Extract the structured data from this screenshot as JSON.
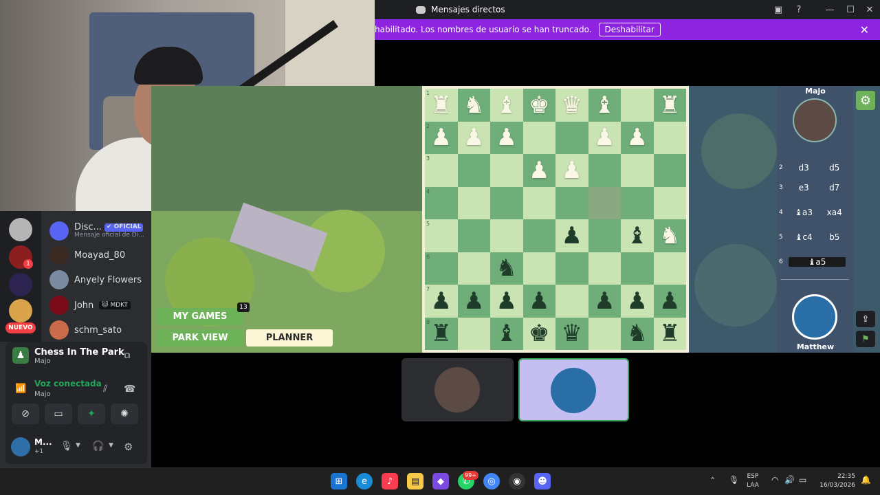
{
  "window": {
    "title": "Mensajes directos"
  },
  "notice": {
    "text": "habilitado. Los nombres de usuario se han truncado.",
    "button_label": "Deshabilitar"
  },
  "dm_list": [
    {
      "name": "Disc...",
      "badge": "✔ OFICIAL",
      "subtitle": "Mensaje oficial de Di..."
    },
    {
      "name": "Moayad_80"
    },
    {
      "name": "Anyely Flowers"
    },
    {
      "name": "John",
      "badge": "🐱 MDKT"
    },
    {
      "name": "schm_sato"
    }
  ],
  "servers": {
    "new_label": "NUEVO",
    "ping_count": "1"
  },
  "voice": {
    "activity_title": "Chess In The Park",
    "activity_sub": "Majo",
    "status": "Voz conectada",
    "channel": "Majo",
    "user_name": "M...",
    "user_sub": "+1"
  },
  "game": {
    "my_games_label": "MY GAMES",
    "my_games_count": "13",
    "park_view_label": "PARK VIEW",
    "planner_label": "PLANNER",
    "opponent_name": "Majo",
    "player_name": "Matthew",
    "ranks": [
      "1",
      "2",
      "3",
      "4",
      "5",
      "6",
      "7",
      "8"
    ],
    "moves": [
      {
        "num": "2",
        "white": "d3",
        "black": "d5"
      },
      {
        "num": "3",
        "white": "e3",
        "black": "d7"
      },
      {
        "num": "4",
        "white": "♝a3",
        "black": "xa4"
      },
      {
        "num": "5",
        "white": "♝c4",
        "black": "b5"
      },
      {
        "num": "6",
        "white": "♝a5",
        "black": ""
      }
    ]
  },
  "taskbar": {
    "lang1": "ESP",
    "lang2": "LAA",
    "time": "22:35",
    "date": "16/03/2026",
    "whatsapp_badge": "99+"
  }
}
